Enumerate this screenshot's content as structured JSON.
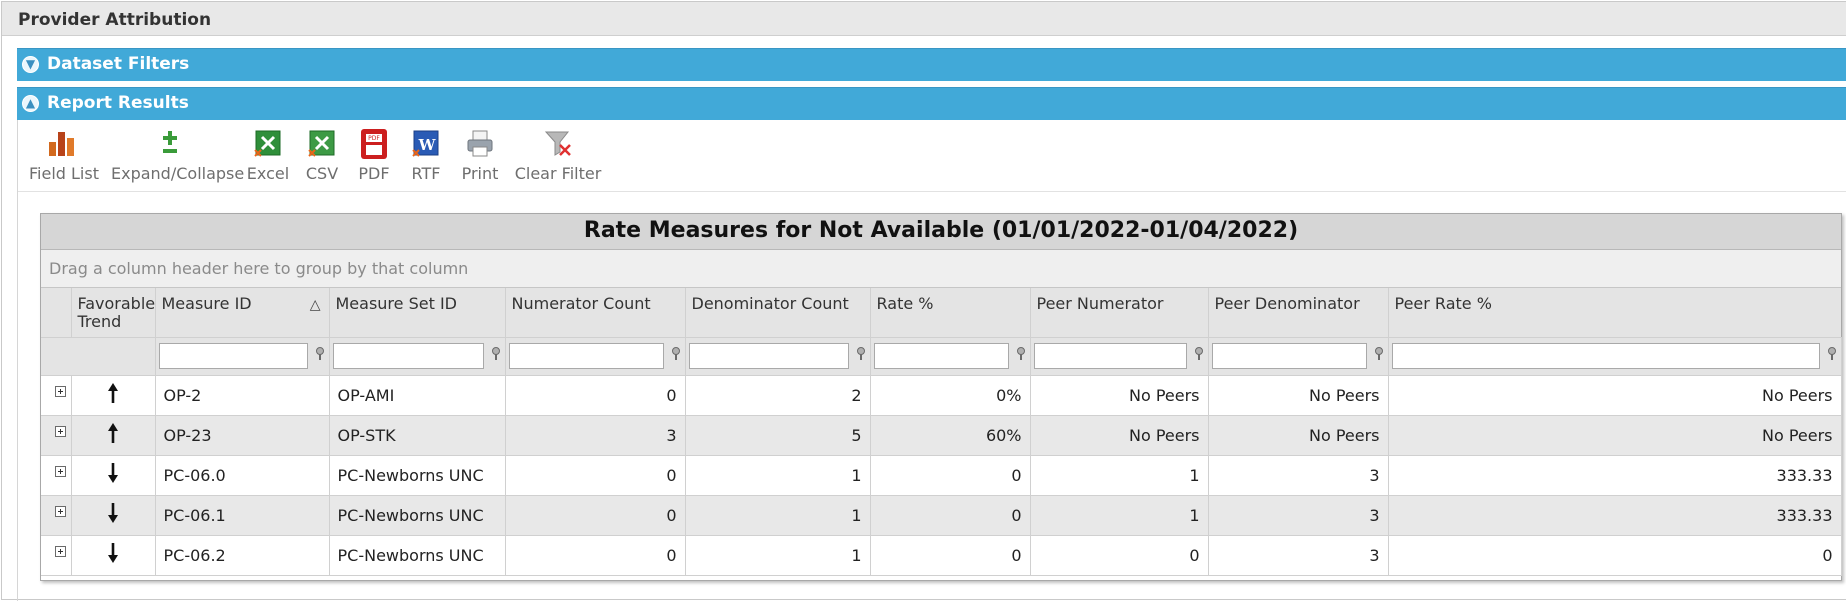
{
  "page": {
    "title": "Provider Attribution"
  },
  "panels": {
    "dataset_filters": {
      "label": "Dataset Filters",
      "state": "collapsed"
    },
    "report_results": {
      "label": "Report Results",
      "state": "expanded"
    }
  },
  "toolbar": {
    "field_list": "Field List",
    "expand_collapse": "Expand/Collapse",
    "excel": "Excel",
    "csv": "CSV",
    "pdf": "PDF",
    "rtf": "RTF",
    "print": "Print",
    "clear_filter": "Clear Filter"
  },
  "grid": {
    "title": "Rate Measures for Not Available (01/01/2022-01/04/2022)",
    "group_panel_hint": "Drag a column header here to group by that column",
    "columns": [
      {
        "label": "Favorable Trend"
      },
      {
        "label": "Measure ID",
        "sort": "ascending"
      },
      {
        "label": "Measure Set ID"
      },
      {
        "label": "Numerator Count"
      },
      {
        "label": "Denominator Count"
      },
      {
        "label": "Rate %"
      },
      {
        "label": "Peer Numerator"
      },
      {
        "label": "Peer Denominator"
      },
      {
        "label": "Peer Rate %"
      }
    ],
    "rows": [
      {
        "trend": "up",
        "measure_id": "OP-2",
        "measure_set_id": "OP-AMI",
        "numerator": "0",
        "denominator": "2",
        "rate": "0%",
        "peer_numerator": "No Peers",
        "peer_denominator": "No Peers",
        "peer_rate": "No Peers"
      },
      {
        "trend": "up",
        "measure_id": "OP-23",
        "measure_set_id": "OP-STK",
        "numerator": "3",
        "denominator": "5",
        "rate": "60%",
        "peer_numerator": "No Peers",
        "peer_denominator": "No Peers",
        "peer_rate": "No Peers"
      },
      {
        "trend": "down",
        "measure_id": "PC-06.0",
        "measure_set_id": "PC-Newborns UNC",
        "numerator": "0",
        "denominator": "1",
        "rate": "0",
        "peer_numerator": "1",
        "peer_denominator": "3",
        "peer_rate": "333.33"
      },
      {
        "trend": "down",
        "measure_id": "PC-06.1",
        "measure_set_id": "PC-Newborns UNC",
        "numerator": "0",
        "denominator": "1",
        "rate": "0",
        "peer_numerator": "1",
        "peer_denominator": "3",
        "peer_rate": "333.33"
      },
      {
        "trend": "down",
        "measure_id": "PC-06.2",
        "measure_set_id": "PC-Newborns UNC",
        "numerator": "0",
        "denominator": "1",
        "rate": "0",
        "peer_numerator": "0",
        "peer_denominator": "3",
        "peer_rate": "0"
      }
    ]
  },
  "colors": {
    "panel_bar": "#41a9d8",
    "favorable_rate": "#2e8b2e",
    "alt_row": "#e8e8e8"
  }
}
